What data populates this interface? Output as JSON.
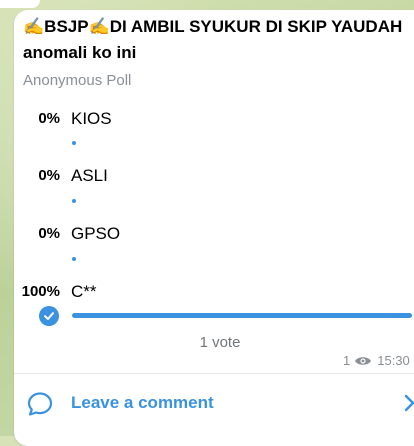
{
  "post": {
    "question_line1": "✍️BSJP✍️DI AMBIL SYUKUR DI SKIP YAUDAH",
    "question_line2": "anomali ko ini",
    "poll_type": "Anonymous Poll"
  },
  "options": [
    {
      "percent": "0%",
      "label": "KIOS",
      "share": 0
    },
    {
      "percent": "0%",
      "label": "ASLI",
      "share": 0
    },
    {
      "percent": "0%",
      "label": "GPSO",
      "share": 0
    },
    {
      "percent": "100%",
      "label": "C**",
      "share": 1,
      "selected": true
    }
  ],
  "footer": {
    "votes": "1 vote",
    "views": "1",
    "time": "15:30"
  },
  "comment": {
    "label": "Leave a comment"
  },
  "colors": {
    "accent": "#3a92e0",
    "bubble": "#ffffff",
    "muted": "#8a8f95"
  },
  "icons": [
    "eye-icon",
    "comment-icon",
    "chevron-right-icon",
    "check-icon"
  ]
}
